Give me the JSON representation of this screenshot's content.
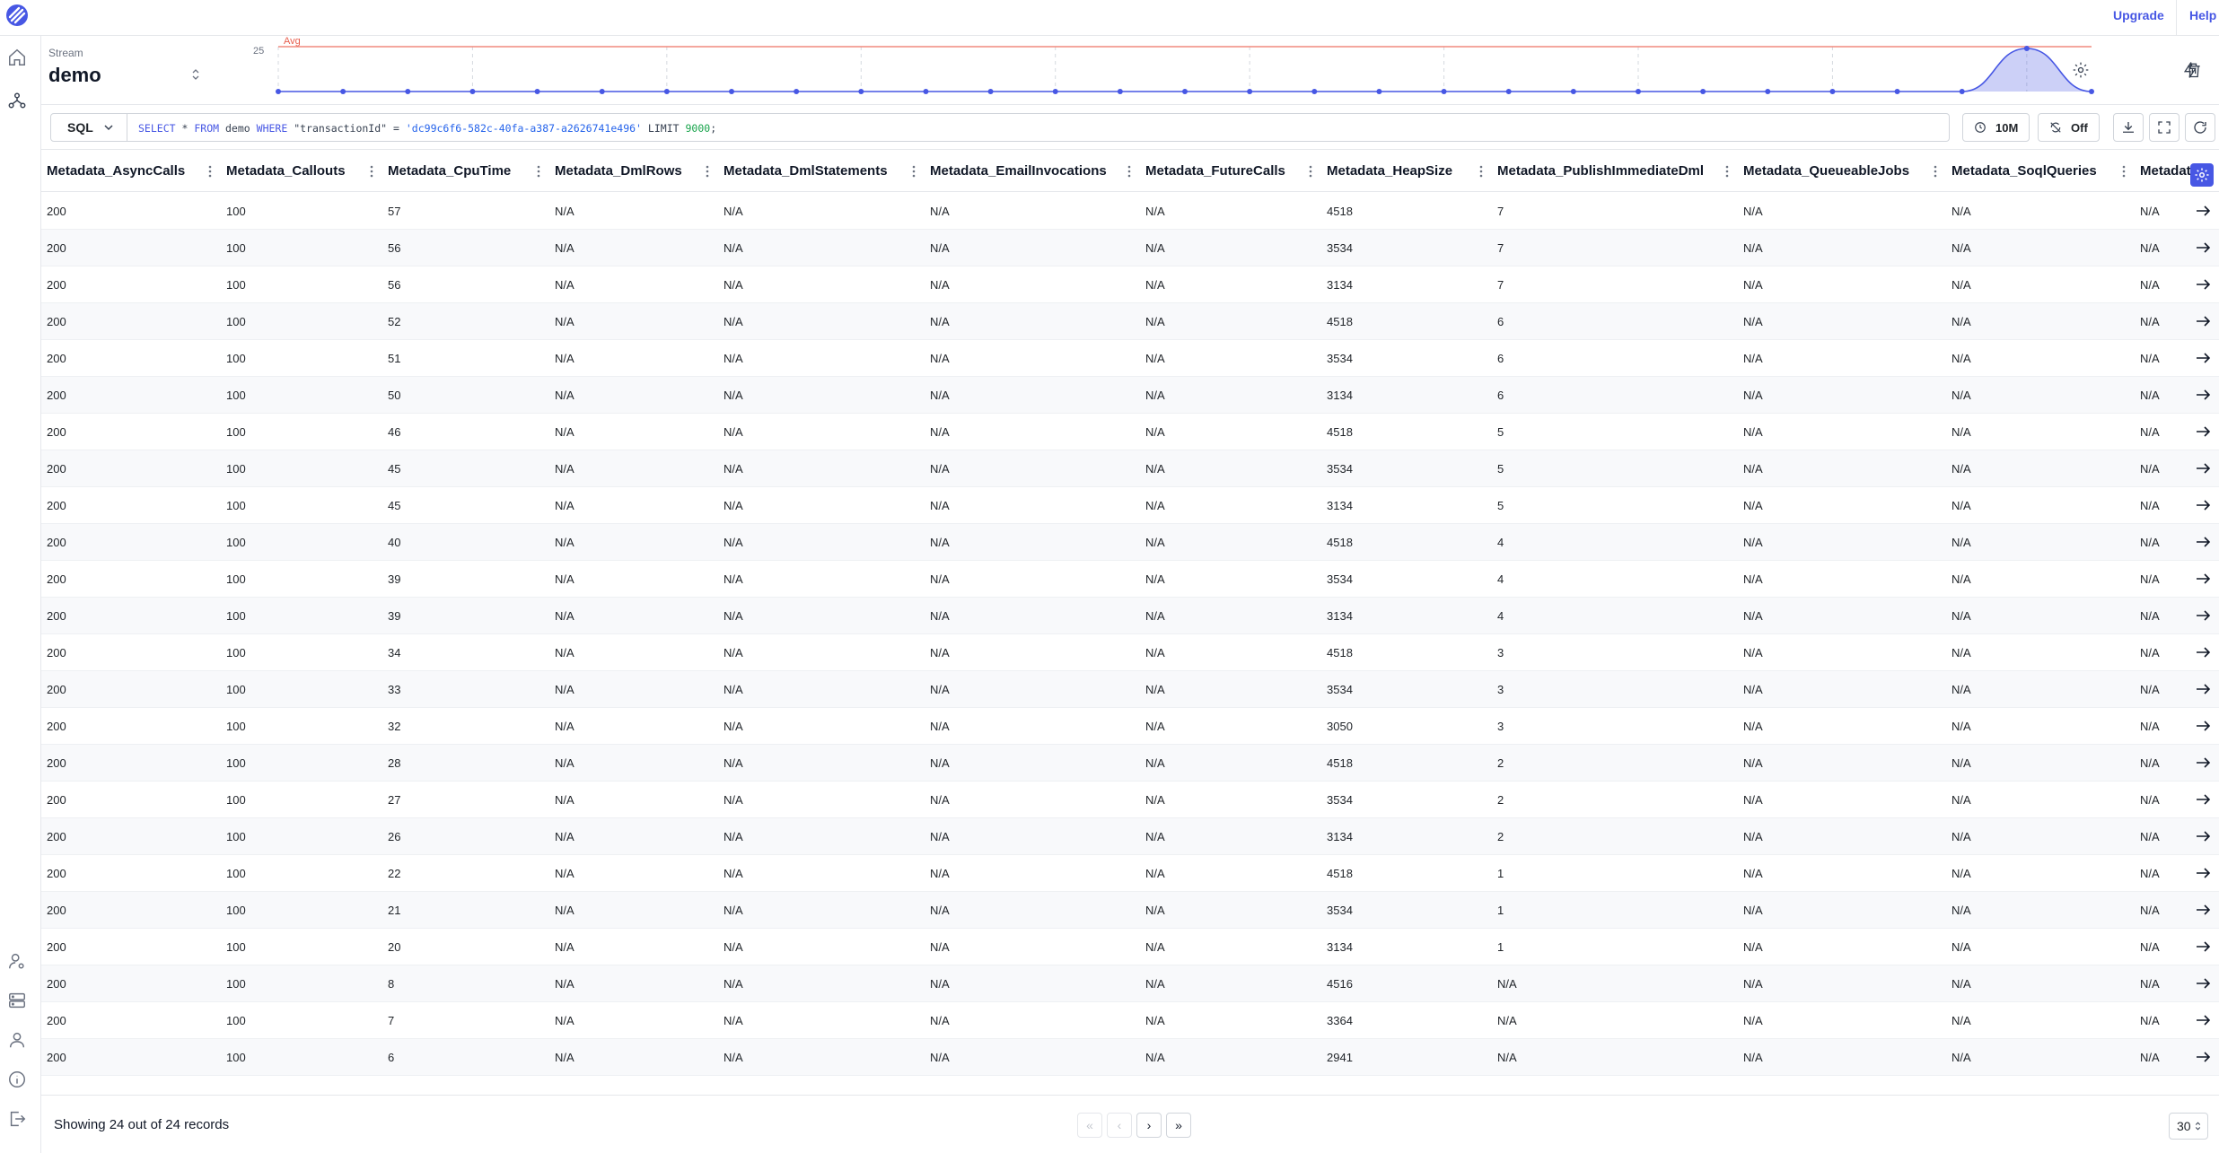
{
  "topbar": {
    "upgrade_label": "Upgrade",
    "help_label": "Help"
  },
  "stream": {
    "label": "Stream",
    "name": "demo"
  },
  "chart_data": {
    "type": "area",
    "y_tick_label": "25",
    "avg_label": "Avg",
    "values": [
      0,
      0,
      0,
      0,
      0,
      0,
      0,
      0,
      0,
      0,
      0,
      0,
      0,
      0,
      0,
      0,
      0,
      0,
      0,
      0,
      0,
      0,
      0,
      0,
      0,
      0,
      0,
      24,
      0
    ],
    "ylim": [
      0,
      25
    ],
    "line_color": "#4757e4",
    "avg_color": "#f08a7e"
  },
  "query": {
    "mode": "SQL",
    "select": "SELECT",
    "star": "*",
    "from": "FROM",
    "stream": "demo",
    "where": "WHERE",
    "field": "\"transactionId\"",
    "op": "=",
    "value": "'dc99c6f6-582c-40fa-a387-a2626741e496'",
    "limit": "LIMIT",
    "limit_value": "9000",
    "end": ";"
  },
  "controls": {
    "time_range": "10M",
    "refresh": "Off"
  },
  "table": {
    "columns": [
      "Metadata_AsyncCalls",
      "Metadata_Callouts",
      "Metadata_CpuTime",
      "Metadata_DmlRows",
      "Metadata_DmlStatements",
      "Metadata_EmailInvocations",
      "Metadata_FutureCalls",
      "Metadata_HeapSize",
      "Metadata_PublishImmediateDml",
      "Metadata_QueueableJobs",
      "Metadata_SoqlQueries",
      "Metadata_SoslQueries"
    ],
    "rows": [
      [
        "200",
        "100",
        "57",
        "N/A",
        "N/A",
        "N/A",
        "N/A",
        "4518",
        "7",
        "N/A",
        "N/A",
        "N/A"
      ],
      [
        "200",
        "100",
        "56",
        "N/A",
        "N/A",
        "N/A",
        "N/A",
        "3534",
        "7",
        "N/A",
        "N/A",
        "N/A"
      ],
      [
        "200",
        "100",
        "56",
        "N/A",
        "N/A",
        "N/A",
        "N/A",
        "3134",
        "7",
        "N/A",
        "N/A",
        "N/A"
      ],
      [
        "200",
        "100",
        "52",
        "N/A",
        "N/A",
        "N/A",
        "N/A",
        "4518",
        "6",
        "N/A",
        "N/A",
        "N/A"
      ],
      [
        "200",
        "100",
        "51",
        "N/A",
        "N/A",
        "N/A",
        "N/A",
        "3534",
        "6",
        "N/A",
        "N/A",
        "N/A"
      ],
      [
        "200",
        "100",
        "50",
        "N/A",
        "N/A",
        "N/A",
        "N/A",
        "3134",
        "6",
        "N/A",
        "N/A",
        "N/A"
      ],
      [
        "200",
        "100",
        "46",
        "N/A",
        "N/A",
        "N/A",
        "N/A",
        "4518",
        "5",
        "N/A",
        "N/A",
        "N/A"
      ],
      [
        "200",
        "100",
        "45",
        "N/A",
        "N/A",
        "N/A",
        "N/A",
        "3534",
        "5",
        "N/A",
        "N/A",
        "N/A"
      ],
      [
        "200",
        "100",
        "45",
        "N/A",
        "N/A",
        "N/A",
        "N/A",
        "3134",
        "5",
        "N/A",
        "N/A",
        "N/A"
      ],
      [
        "200",
        "100",
        "40",
        "N/A",
        "N/A",
        "N/A",
        "N/A",
        "4518",
        "4",
        "N/A",
        "N/A",
        "N/A"
      ],
      [
        "200",
        "100",
        "39",
        "N/A",
        "N/A",
        "N/A",
        "N/A",
        "3534",
        "4",
        "N/A",
        "N/A",
        "N/A"
      ],
      [
        "200",
        "100",
        "39",
        "N/A",
        "N/A",
        "N/A",
        "N/A",
        "3134",
        "4",
        "N/A",
        "N/A",
        "N/A"
      ],
      [
        "200",
        "100",
        "34",
        "N/A",
        "N/A",
        "N/A",
        "N/A",
        "4518",
        "3",
        "N/A",
        "N/A",
        "N/A"
      ],
      [
        "200",
        "100",
        "33",
        "N/A",
        "N/A",
        "N/A",
        "N/A",
        "3534",
        "3",
        "N/A",
        "N/A",
        "N/A"
      ],
      [
        "200",
        "100",
        "32",
        "N/A",
        "N/A",
        "N/A",
        "N/A",
        "3050",
        "3",
        "N/A",
        "N/A",
        "N/A"
      ],
      [
        "200",
        "100",
        "28",
        "N/A",
        "N/A",
        "N/A",
        "N/A",
        "4518",
        "2",
        "N/A",
        "N/A",
        "N/A"
      ],
      [
        "200",
        "100",
        "27",
        "N/A",
        "N/A",
        "N/A",
        "N/A",
        "3534",
        "2",
        "N/A",
        "N/A",
        "N/A"
      ],
      [
        "200",
        "100",
        "26",
        "N/A",
        "N/A",
        "N/A",
        "N/A",
        "3134",
        "2",
        "N/A",
        "N/A",
        "N/A"
      ],
      [
        "200",
        "100",
        "22",
        "N/A",
        "N/A",
        "N/A",
        "N/A",
        "4518",
        "1",
        "N/A",
        "N/A",
        "N/A"
      ],
      [
        "200",
        "100",
        "21",
        "N/A",
        "N/A",
        "N/A",
        "N/A",
        "3534",
        "1",
        "N/A",
        "N/A",
        "N/A"
      ],
      [
        "200",
        "100",
        "20",
        "N/A",
        "N/A",
        "N/A",
        "N/A",
        "3134",
        "1",
        "N/A",
        "N/A",
        "N/A"
      ],
      [
        "200",
        "100",
        "8",
        "N/A",
        "N/A",
        "N/A",
        "N/A",
        "4516",
        "N/A",
        "N/A",
        "N/A",
        "N/A"
      ],
      [
        "200",
        "100",
        "7",
        "N/A",
        "N/A",
        "N/A",
        "N/A",
        "3364",
        "N/A",
        "N/A",
        "N/A",
        "N/A"
      ],
      [
        "200",
        "100",
        "6",
        "N/A",
        "N/A",
        "N/A",
        "N/A",
        "2941",
        "N/A",
        "N/A",
        "N/A",
        "N/A"
      ]
    ]
  },
  "footer": {
    "summary": "Showing 24 out of 24 records",
    "per_page": "30"
  }
}
